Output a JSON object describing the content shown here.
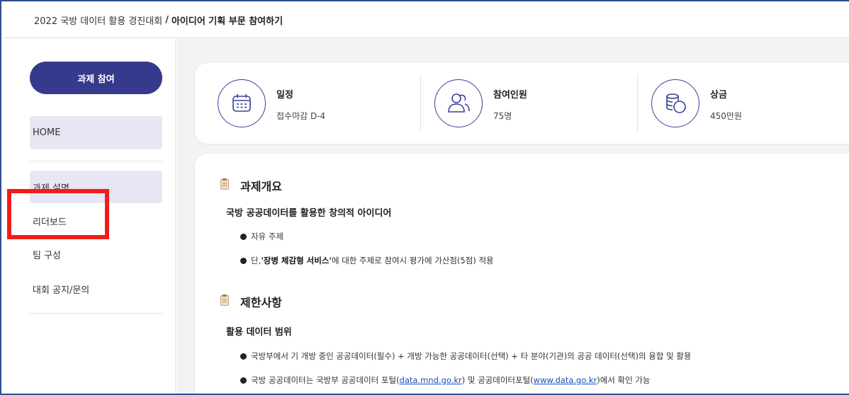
{
  "breadcrumb": {
    "event": "2022 국방 데이터 활용 경진대회",
    "separator": "/",
    "section": "아이디어 기획 부문 참여하기"
  },
  "sidebar": {
    "join_button": "과제 참여",
    "home": "HOME",
    "items": [
      {
        "label": "과제 설명"
      },
      {
        "label": "리더보드"
      },
      {
        "label": "팀 구성"
      },
      {
        "label": "대회 공지/문의"
      }
    ]
  },
  "stats": [
    {
      "icon": "calendar-icon",
      "title": "일정",
      "value": "접수마감 D-4"
    },
    {
      "icon": "people-icon",
      "title": "참여인원",
      "value": "75명"
    },
    {
      "icon": "coins-icon",
      "title": "상금",
      "value": "450만원"
    }
  ],
  "overview": {
    "heading": "과제개요",
    "subheading": "국방 공공데이터를 활용한 창의적 아이디어",
    "bullet1": "자유 주제",
    "bullet2_prefix": "단, ",
    "bullet2_bold": "'장병 체감형 서비스'",
    "bullet2_suffix": "에 대한 주제로 참여시 평가에 가산점(5점) 적용"
  },
  "restrictions": {
    "heading": "제한사항",
    "subheading": "활용 데이터 범위",
    "bullet1": "국방부에서 기 개방 중인 공공데이터(필수) + 개방 가능한 공공데이터(선택) + 타 분야(기관)의 공공 데이터(선택)의 융합 및 활용",
    "bullet2_a": "국방 공공데이터는 국방부 공공데이터 포털(",
    "bullet2_link1": "data.mnd.go.kr",
    "bullet2_b": ") 및 공공데이터포털(",
    "bullet2_link2": "www.data.go.kr",
    "bullet2_c": ")에서 확인 가능"
  },
  "colors": {
    "accent": "#363a8c",
    "nav_active_bg": "#e7e6f3",
    "highlight": "#f21b1b",
    "link": "#1d4fb8"
  }
}
